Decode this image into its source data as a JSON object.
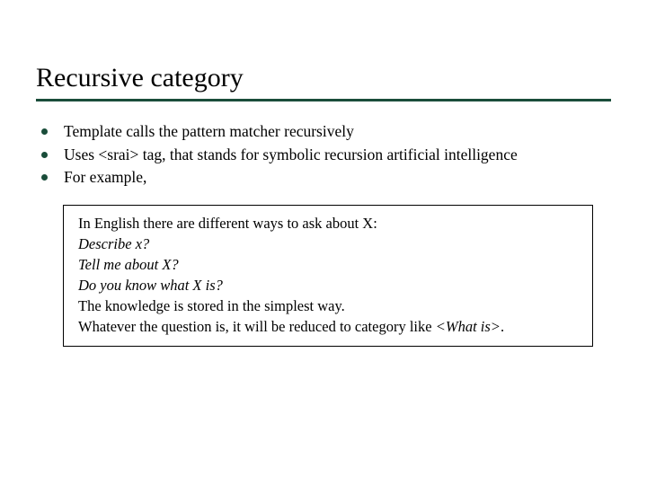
{
  "title": "Recursive category",
  "bullets": [
    {
      "text": "Template calls the pattern matcher recursively"
    },
    {
      "text": "Uses <srai> tag, that stands for symbolic recursion artificial intelligence"
    },
    {
      "text": "For example,"
    }
  ],
  "example": {
    "intro": "In English there are different ways to ask about X:",
    "q1": "Describe x?",
    "q2": "Tell me about X?",
    "q3": "Do you know what X is?",
    "stored": "The knowledge is stored in the simplest way.",
    "reduced_pre": "Whatever the question is, it  will be reduced to category like ",
    "reduced_tag": "<What is>",
    "reduced_post": "."
  }
}
